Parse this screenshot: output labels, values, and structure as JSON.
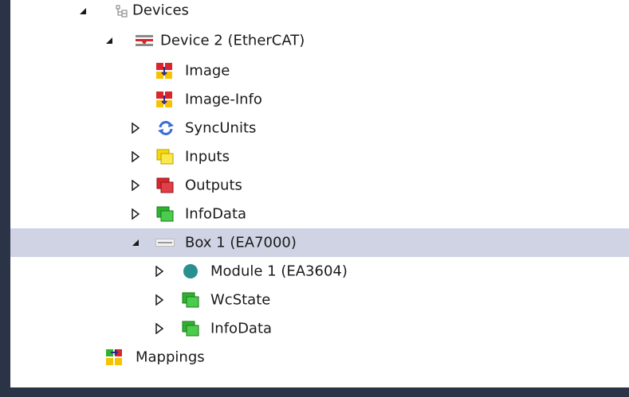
{
  "tree": {
    "items": [
      {
        "label": "Devices",
        "icon": "devices-icon"
      },
      {
        "label": "Device 2 (EtherCAT)",
        "icon": "ethercat-device-icon"
      },
      {
        "label": "Image",
        "icon": "image-icon"
      },
      {
        "label": "Image-Info",
        "icon": "image-info-icon"
      },
      {
        "label": "SyncUnits",
        "icon": "sync-units-icon"
      },
      {
        "label": "Inputs",
        "icon": "inputs-icon"
      },
      {
        "label": "Outputs",
        "icon": "outputs-icon"
      },
      {
        "label": "InfoData",
        "icon": "infodata-icon"
      },
      {
        "label": "Box 1 (EA7000)",
        "icon": "box-icon"
      },
      {
        "label": "Module 1 (EA3604)",
        "icon": "module-icon"
      },
      {
        "label": "WcState",
        "icon": "wcstate-icon"
      },
      {
        "label": "InfoData",
        "icon": "infodata-icon"
      },
      {
        "label": "Mappings",
        "icon": "mappings-icon"
      }
    ]
  },
  "colors": {
    "selection": "#cfd3e3",
    "frame": "#2b3447",
    "inputs": "#f5d90a",
    "outputs": "#d9262b",
    "infodata": "#2fb22f",
    "module": "#2a8f8f",
    "sync": "#3a6fd1"
  }
}
